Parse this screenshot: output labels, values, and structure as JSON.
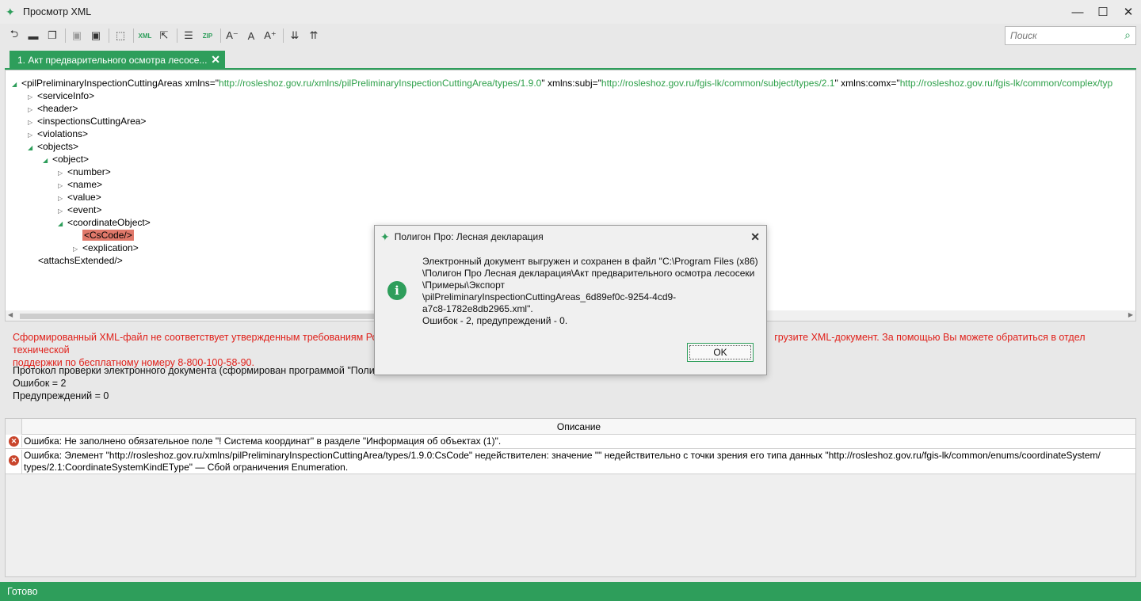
{
  "window": {
    "title": "Просмотр XML",
    "minimize_icon": "—",
    "maximize_icon": "☐",
    "close_icon": "✕"
  },
  "toolbar": {
    "xml_label": "XML",
    "zip_label": "ZIP"
  },
  "search": {
    "placeholder": "Поиск"
  },
  "tab": {
    "label": "1. Акт предварительного осмотра лесосе..."
  },
  "xml_tree": {
    "root": {
      "tag_start": "<pilPreliminaryInspectionCuttingAreas xmlns=\"",
      "url1": "http://rosleshoz.gov.ru/xmlns/pilPreliminaryInspectionCuttingArea/types/1.9.0",
      "mid1": "\" xmlns:subj=\"",
      "url2": "http://rosleshoz.gov.ru/fgis-lk/common/subject/types/2.1",
      "mid2": "\" xmlns:comx=\"",
      "url3": "http://rosleshoz.gov.ru/fgis-lk/common/complex/typ"
    },
    "nodes": [
      "<serviceInfo>",
      "<header>",
      "<inspectionsCuttingArea>",
      "<violations>",
      "<objects>",
      "<object>",
      "<number>",
      "<name>",
      "<value>",
      "<event>",
      "<coordinateObject>",
      "<CsCode/>",
      "<explication>",
      "<attachsExtended/>"
    ]
  },
  "error_message": "Сформированный XML-файл не соответствует утвержденным требованиям Рослес",
  "error_message_tail": "грузите XML-документ. За помощью Вы можете обратиться в отдел технической",
  "error_message_line2": "поддержки по бесплатному номеру 8-800-100-58-90.",
  "protocol": {
    "line1": "Протокол проверки электронного документа (сформирован программой \"Полиго",
    "errors": "Ошибок = 2",
    "warnings": "Предупреждений = 0"
  },
  "table": {
    "header": "Описание",
    "rows": [
      "Ошибка: Не заполнено обязательное поле \"! Система координат\" в разделе \"Информация об объектах (1)\".",
      "Ошибка: Элемент \"http://rosleshoz.gov.ru/xmlns/pilPreliminaryInspectionCuttingArea/types/1.9.0:CsCode\" недействителен: значение \"\" недействительно с точки зрения его типа данных \"http://rosleshoz.gov.ru/fgis-lk/common/enums/coordinateSystem/\ntypes/2.1:CoordinateSystemKindEType\" — Сбой ограничения Enumeration."
    ]
  },
  "status": "Готово",
  "dialog": {
    "title": "Полигон Про: Лесная декларация",
    "message": "Электронный документ выгружен и сохранен в файл \"C:\\Program Files (x86)\n\\Полигон Про Лесная декларация\\Акт предварительного осмотра лесосеки\n\\Примеры\\Экспорт\n\\pilPreliminaryInspectionCuttingAreas_6d89ef0c-9254-4cd9-\na7c8-1782e8db2965.xml\".\nОшибок - 2, предупреждений - 0.",
    "ok_label": "OK"
  },
  "colors": {
    "accent": "#2e9e5b",
    "error": "#e0201a",
    "selection": "#e0786a"
  }
}
